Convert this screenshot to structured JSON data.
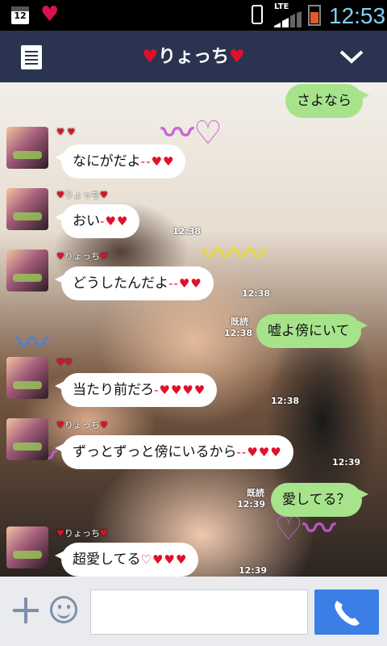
{
  "status_bar": {
    "calendar_day": "12",
    "network": "LTE",
    "time": "12:53",
    "icons": [
      "calendar-icon",
      "heart-icon",
      "vibrate-icon",
      "signal-icon",
      "battery-icon"
    ]
  },
  "header": {
    "heart_left": "♥",
    "name": "りょっち",
    "heart_right": "♥",
    "menu_icon": "menu-icon",
    "collapse_icon": "chevron-down-icon"
  },
  "messages": [
    {
      "dir": "out",
      "text": "さよなら",
      "hearts": "",
      "read": "",
      "time": ""
    },
    {
      "dir": "in",
      "sender": "♥ ♥",
      "text": "なにがだよ",
      "hearts": "--♥♥",
      "time": ""
    },
    {
      "dir": "in",
      "sender": "りょっち",
      "text": "おい",
      "hearts": "-♥♥",
      "time": "12:38"
    },
    {
      "dir": "in",
      "sender": "りょっち",
      "text": "どうしたんだよ",
      "hearts": "--♥♥",
      "time": "12:38"
    },
    {
      "dir": "out",
      "text": "嘘よ傍にいて",
      "hearts": "",
      "read": "既読",
      "time": "12:38"
    },
    {
      "dir": "in",
      "sender": "",
      "text": "当たり前だろ",
      "hearts": "-♥♥♥♥",
      "time": "12:38"
    },
    {
      "dir": "in",
      "sender": "りょっち",
      "text": "ずっとずっと傍にいるから",
      "hearts": "--♥♥♥",
      "time": "12:39"
    },
    {
      "dir": "out",
      "text": "愛してる？",
      "hearts": "",
      "read": "既読",
      "time": "12:39"
    },
    {
      "dir": "in",
      "sender": "りょっち",
      "text": "超愛してる",
      "hearts": "♡♥♥♥",
      "time": "12:39"
    }
  ],
  "input": {
    "placeholder": "",
    "icons": [
      "plus-icon",
      "emoji-icon",
      "phone-icon"
    ]
  },
  "colors": {
    "header_bg": "#2a3450",
    "bubble_out": "#a7e38b",
    "bubble_in": "#ffffff",
    "call_button": "#3b7fe6"
  }
}
